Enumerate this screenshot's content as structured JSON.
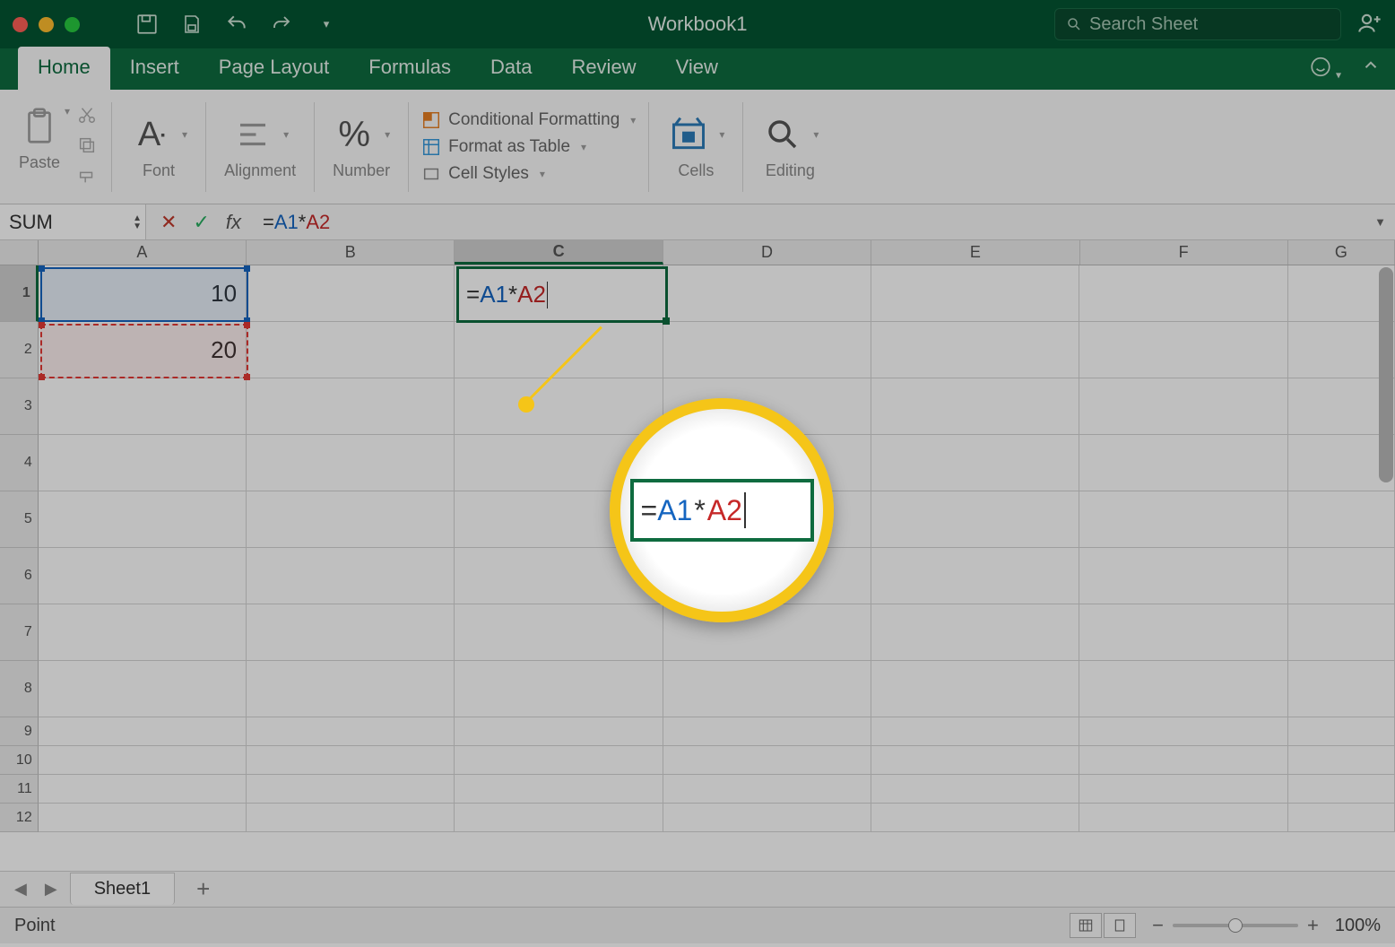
{
  "titlebar": {
    "document_title": "Workbook1",
    "search_placeholder": "Search Sheet"
  },
  "ribbon_tabs": {
    "items": [
      {
        "label": "Home"
      },
      {
        "label": "Insert"
      },
      {
        "label": "Page Layout"
      },
      {
        "label": "Formulas"
      },
      {
        "label": "Data"
      },
      {
        "label": "Review"
      },
      {
        "label": "View"
      }
    ],
    "active_index": 0
  },
  "ribbon_groups": {
    "paste": "Paste",
    "font": "Font",
    "alignment": "Alignment",
    "number": "Number",
    "cells": "Cells",
    "editing": "Editing",
    "styles": {
      "conditional": "Conditional Formatting",
      "table": "Format as Table",
      "cell_styles": "Cell Styles"
    }
  },
  "formula_bar": {
    "name_box": "SUM",
    "fx_label": "fx",
    "formula": {
      "equals": "=",
      "ref1": "A1",
      "op": "*",
      "ref2": "A2"
    }
  },
  "grid": {
    "columns": [
      "A",
      "B",
      "C",
      "D",
      "E",
      "F",
      "G"
    ],
    "active_column": "C",
    "active_row": 1,
    "rows_visible": [
      1,
      2,
      3,
      4,
      5,
      6,
      7,
      8,
      9,
      10,
      11,
      12
    ],
    "cells": {
      "A1": "10",
      "A2": "20"
    },
    "editing_cell": {
      "ref": "C1",
      "equals": "=",
      "ref1": "A1",
      "op": "*",
      "ref2": "A2"
    }
  },
  "sheet_tabs": {
    "active": "Sheet1"
  },
  "status_bar": {
    "mode": "Point",
    "zoom": "100%"
  },
  "callout": {
    "equals": "=",
    "ref1": "A1",
    "op": "*",
    "ref2": "A2"
  }
}
